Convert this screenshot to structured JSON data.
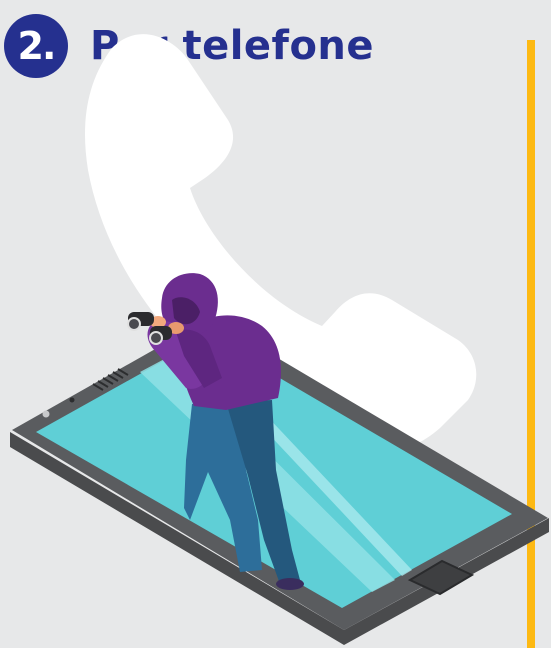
{
  "header": {
    "step_number": "2.",
    "title": "Por telefone"
  },
  "colors": {
    "background": "#e7e8e9",
    "brand_blue": "#25308f",
    "accent_yellow": "#fdb913",
    "screen_cyan": "#5fcfd6",
    "hoodie_purple": "#6b2d8f",
    "jeans_blue": "#2d6e9a"
  },
  "illustration": {
    "icons": [
      "phone-handset-icon",
      "smartphone-icon",
      "spy-with-binoculars-icon"
    ]
  }
}
